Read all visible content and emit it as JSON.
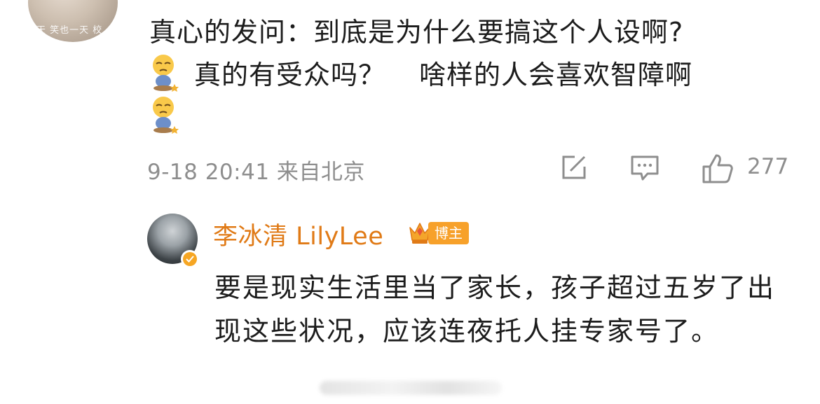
{
  "top_comment": {
    "avatar_caption": "天 笑也一天 校",
    "line1": "真心的发问：到底是为什么要搞这个人设啊?",
    "line2a": "真的有受众吗？",
    "line2b": "啥样的人会喜欢智障啊",
    "emoji_name": "sad-face-emoji",
    "meta": "9-18 20:41 来自北京",
    "like_count": "277"
  },
  "reply": {
    "author_name": "李冰清 LilyLee",
    "badge_label": "博主",
    "text": "要是现实生活里当了家长，孩子超过五岁了出现这些状况，应该连夜托人挂专家号了。"
  },
  "colors": {
    "author_name": "#e07a16",
    "badge_bg": "#f7a12a",
    "meta_gray": "#8e8e8e"
  }
}
